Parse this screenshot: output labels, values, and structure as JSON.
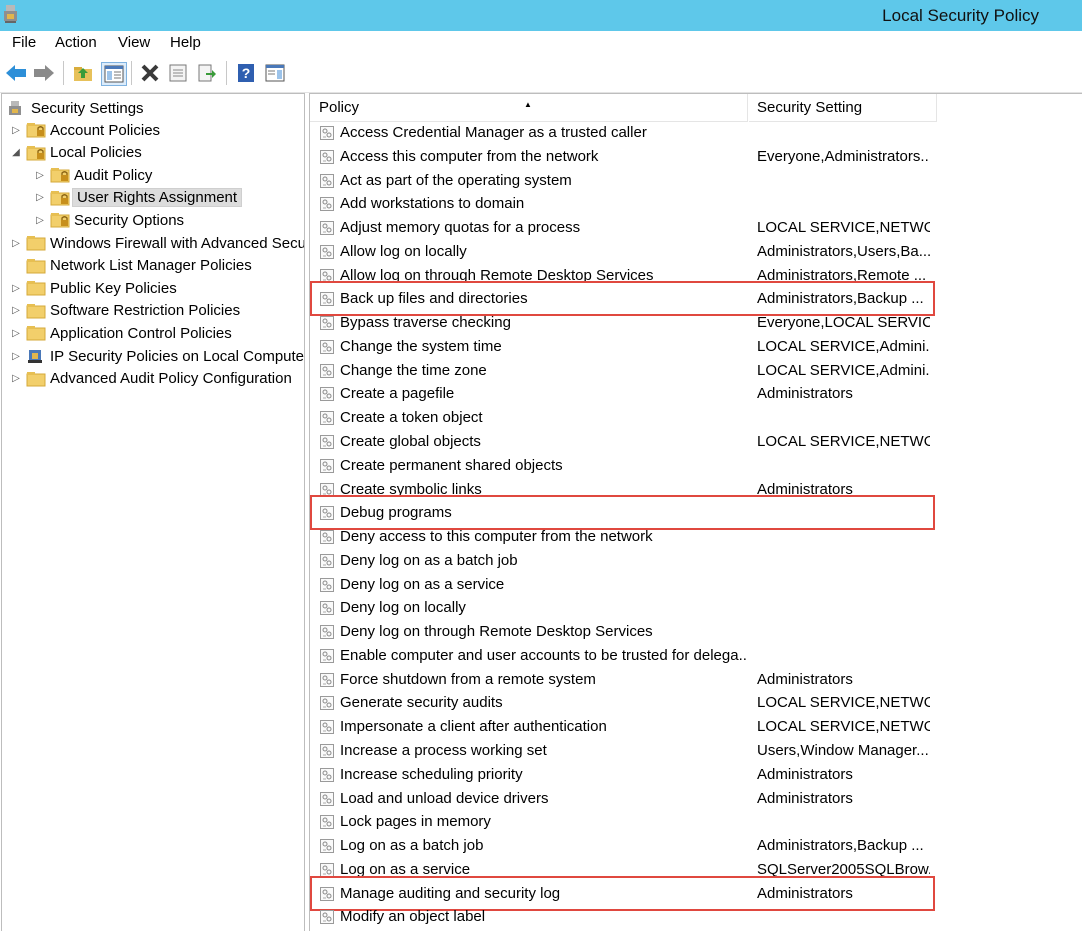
{
  "window": {
    "title": "Local Security Policy"
  },
  "menu": [
    "File",
    "Action",
    "View",
    "Help"
  ],
  "toolbar": {
    "buttons": [
      "back-icon",
      "forward-icon",
      "up-folder-icon",
      "show-tree-icon",
      "delete-icon",
      "properties-icon",
      "export-icon",
      "help-icon",
      "console-icon"
    ]
  },
  "tree": {
    "root": "Security Settings",
    "items": [
      {
        "label": "Account Policies",
        "level": 1,
        "expander": "collapsed",
        "icon": "folder-lock-icon"
      },
      {
        "label": "Local Policies",
        "level": 1,
        "expander": "expanded",
        "icon": "folder-lock-icon"
      },
      {
        "label": "Audit Policy",
        "level": 2,
        "expander": "collapsed",
        "icon": "folder-lock-icon"
      },
      {
        "label": "User Rights Assignment",
        "level": 2,
        "expander": "collapsed",
        "icon": "folder-lock-icon",
        "selected": true
      },
      {
        "label": "Security Options",
        "level": 2,
        "expander": "collapsed",
        "icon": "folder-lock-icon"
      },
      {
        "label": "Windows Firewall with Advanced Security",
        "level": 1,
        "expander": "collapsed",
        "icon": "folder-icon"
      },
      {
        "label": "Network List Manager Policies",
        "level": 1,
        "expander": "none",
        "icon": "folder-icon"
      },
      {
        "label": "Public Key Policies",
        "level": 1,
        "expander": "collapsed",
        "icon": "folder-icon"
      },
      {
        "label": "Software Restriction Policies",
        "level": 1,
        "expander": "collapsed",
        "icon": "folder-icon"
      },
      {
        "label": "Application Control Policies",
        "level": 1,
        "expander": "collapsed",
        "icon": "folder-icon"
      },
      {
        "label": "IP Security Policies on Local Computer",
        "level": 1,
        "expander": "collapsed",
        "icon": "ipsec-icon"
      },
      {
        "label": "Advanced Audit Policy Configuration",
        "level": 1,
        "expander": "collapsed",
        "icon": "folder-icon"
      }
    ]
  },
  "list": {
    "columns": [
      "Policy",
      "Security Setting"
    ],
    "rows": [
      {
        "policy": "Access Credential Manager as a trusted caller",
        "setting": ""
      },
      {
        "policy": "Access this computer from the network",
        "setting": "Everyone,Administrators..."
      },
      {
        "policy": "Act as part of the operating system",
        "setting": ""
      },
      {
        "policy": "Add workstations to domain",
        "setting": ""
      },
      {
        "policy": "Adjust memory quotas for a process",
        "setting": "LOCAL SERVICE,NETWO..."
      },
      {
        "policy": "Allow log on locally",
        "setting": "Administrators,Users,Ba..."
      },
      {
        "policy": "Allow log on through Remote Desktop Services",
        "setting": "Administrators,Remote ..."
      },
      {
        "policy": "Back up files and directories",
        "setting": "Administrators,Backup ...",
        "highlighted": true
      },
      {
        "policy": "Bypass traverse checking",
        "setting": "Everyone,LOCAL SERVIC..."
      },
      {
        "policy": "Change the system time",
        "setting": "LOCAL SERVICE,Admini..."
      },
      {
        "policy": "Change the time zone",
        "setting": "LOCAL SERVICE,Admini..."
      },
      {
        "policy": "Create a pagefile",
        "setting": "Administrators"
      },
      {
        "policy": "Create a token object",
        "setting": ""
      },
      {
        "policy": "Create global objects",
        "setting": "LOCAL SERVICE,NETWO..."
      },
      {
        "policy": "Create permanent shared objects",
        "setting": ""
      },
      {
        "policy": "Create symbolic links",
        "setting": "Administrators"
      },
      {
        "policy": "Debug programs",
        "setting": "",
        "highlighted": true
      },
      {
        "policy": "Deny access to this computer from the network",
        "setting": ""
      },
      {
        "policy": "Deny log on as a batch job",
        "setting": ""
      },
      {
        "policy": "Deny log on as a service",
        "setting": ""
      },
      {
        "policy": "Deny log on locally",
        "setting": ""
      },
      {
        "policy": "Deny log on through Remote Desktop Services",
        "setting": ""
      },
      {
        "policy": "Enable computer and user accounts to be trusted for delega...",
        "setting": ""
      },
      {
        "policy": "Force shutdown from a remote system",
        "setting": "Administrators"
      },
      {
        "policy": "Generate security audits",
        "setting": "LOCAL SERVICE,NETWO..."
      },
      {
        "policy": "Impersonate a client after authentication",
        "setting": "LOCAL SERVICE,NETWO..."
      },
      {
        "policy": "Increase a process working set",
        "setting": "Users,Window Manager..."
      },
      {
        "policy": "Increase scheduling priority",
        "setting": "Administrators"
      },
      {
        "policy": "Load and unload device drivers",
        "setting": "Administrators"
      },
      {
        "policy": "Lock pages in memory",
        "setting": ""
      },
      {
        "policy": "Log on as a batch job",
        "setting": "Administrators,Backup ..."
      },
      {
        "policy": "Log on as a service",
        "setting": "SQLServer2005SQLBrow..."
      },
      {
        "policy": "Manage auditing and security log",
        "setting": "Administrators",
        "highlighted": true
      },
      {
        "policy": "Modify an object label",
        "setting": ""
      }
    ]
  },
  "colors": {
    "titlebar": "#5ec8ea",
    "highlight": "#e0483f"
  }
}
